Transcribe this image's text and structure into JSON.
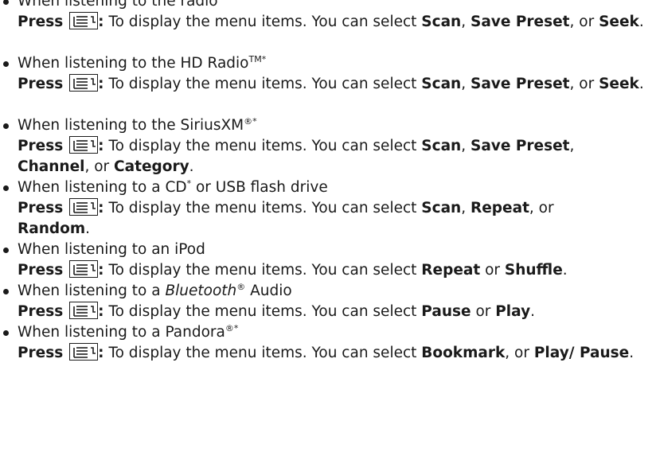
{
  "common": {
    "press": "Press",
    "colon": ":",
    "desc_prefix": " To display the menu items. You can select ",
    "sep_comma": ", ",
    "sep_comma_or": ", or ",
    "sep_or": " or ",
    "period": ".",
    "icon": "menu-button-icon"
  },
  "items": [
    {
      "cond": "When listening to the radio",
      "opts": [
        "Scan",
        "Save Preset",
        "Seek"
      ]
    },
    {
      "cond_a": "When listening to the HD Radio",
      "cond_sup": "TM*",
      "opts": [
        "Scan",
        "Save Preset",
        "Seek"
      ]
    },
    {
      "cond_a": "When listening to the SiriusXM",
      "cond_sup": "®*",
      "opts": [
        "Scan",
        "Save Preset",
        "Channel",
        "Category"
      ]
    },
    {
      "cond_a": "When listening to a CD",
      "cond_sup": "*",
      "cond_b": " or USB flash drive",
      "opts": [
        "Scan",
        "Repeat",
        "Random"
      ]
    },
    {
      "cond": "When listening to an iPod",
      "opts": [
        "Repeat",
        "Shuffle"
      ]
    },
    {
      "cond_a": "When listening to a ",
      "cond_italic": "Bluetooth",
      "cond_sup": "®",
      "cond_b": " Audio",
      "opts": [
        "Pause",
        "Play"
      ]
    },
    {
      "cond_a": "When listening to a Pandora",
      "cond_sup": "®*",
      "opts": [
        "Bookmark",
        "Play/ Pause"
      ]
    }
  ]
}
